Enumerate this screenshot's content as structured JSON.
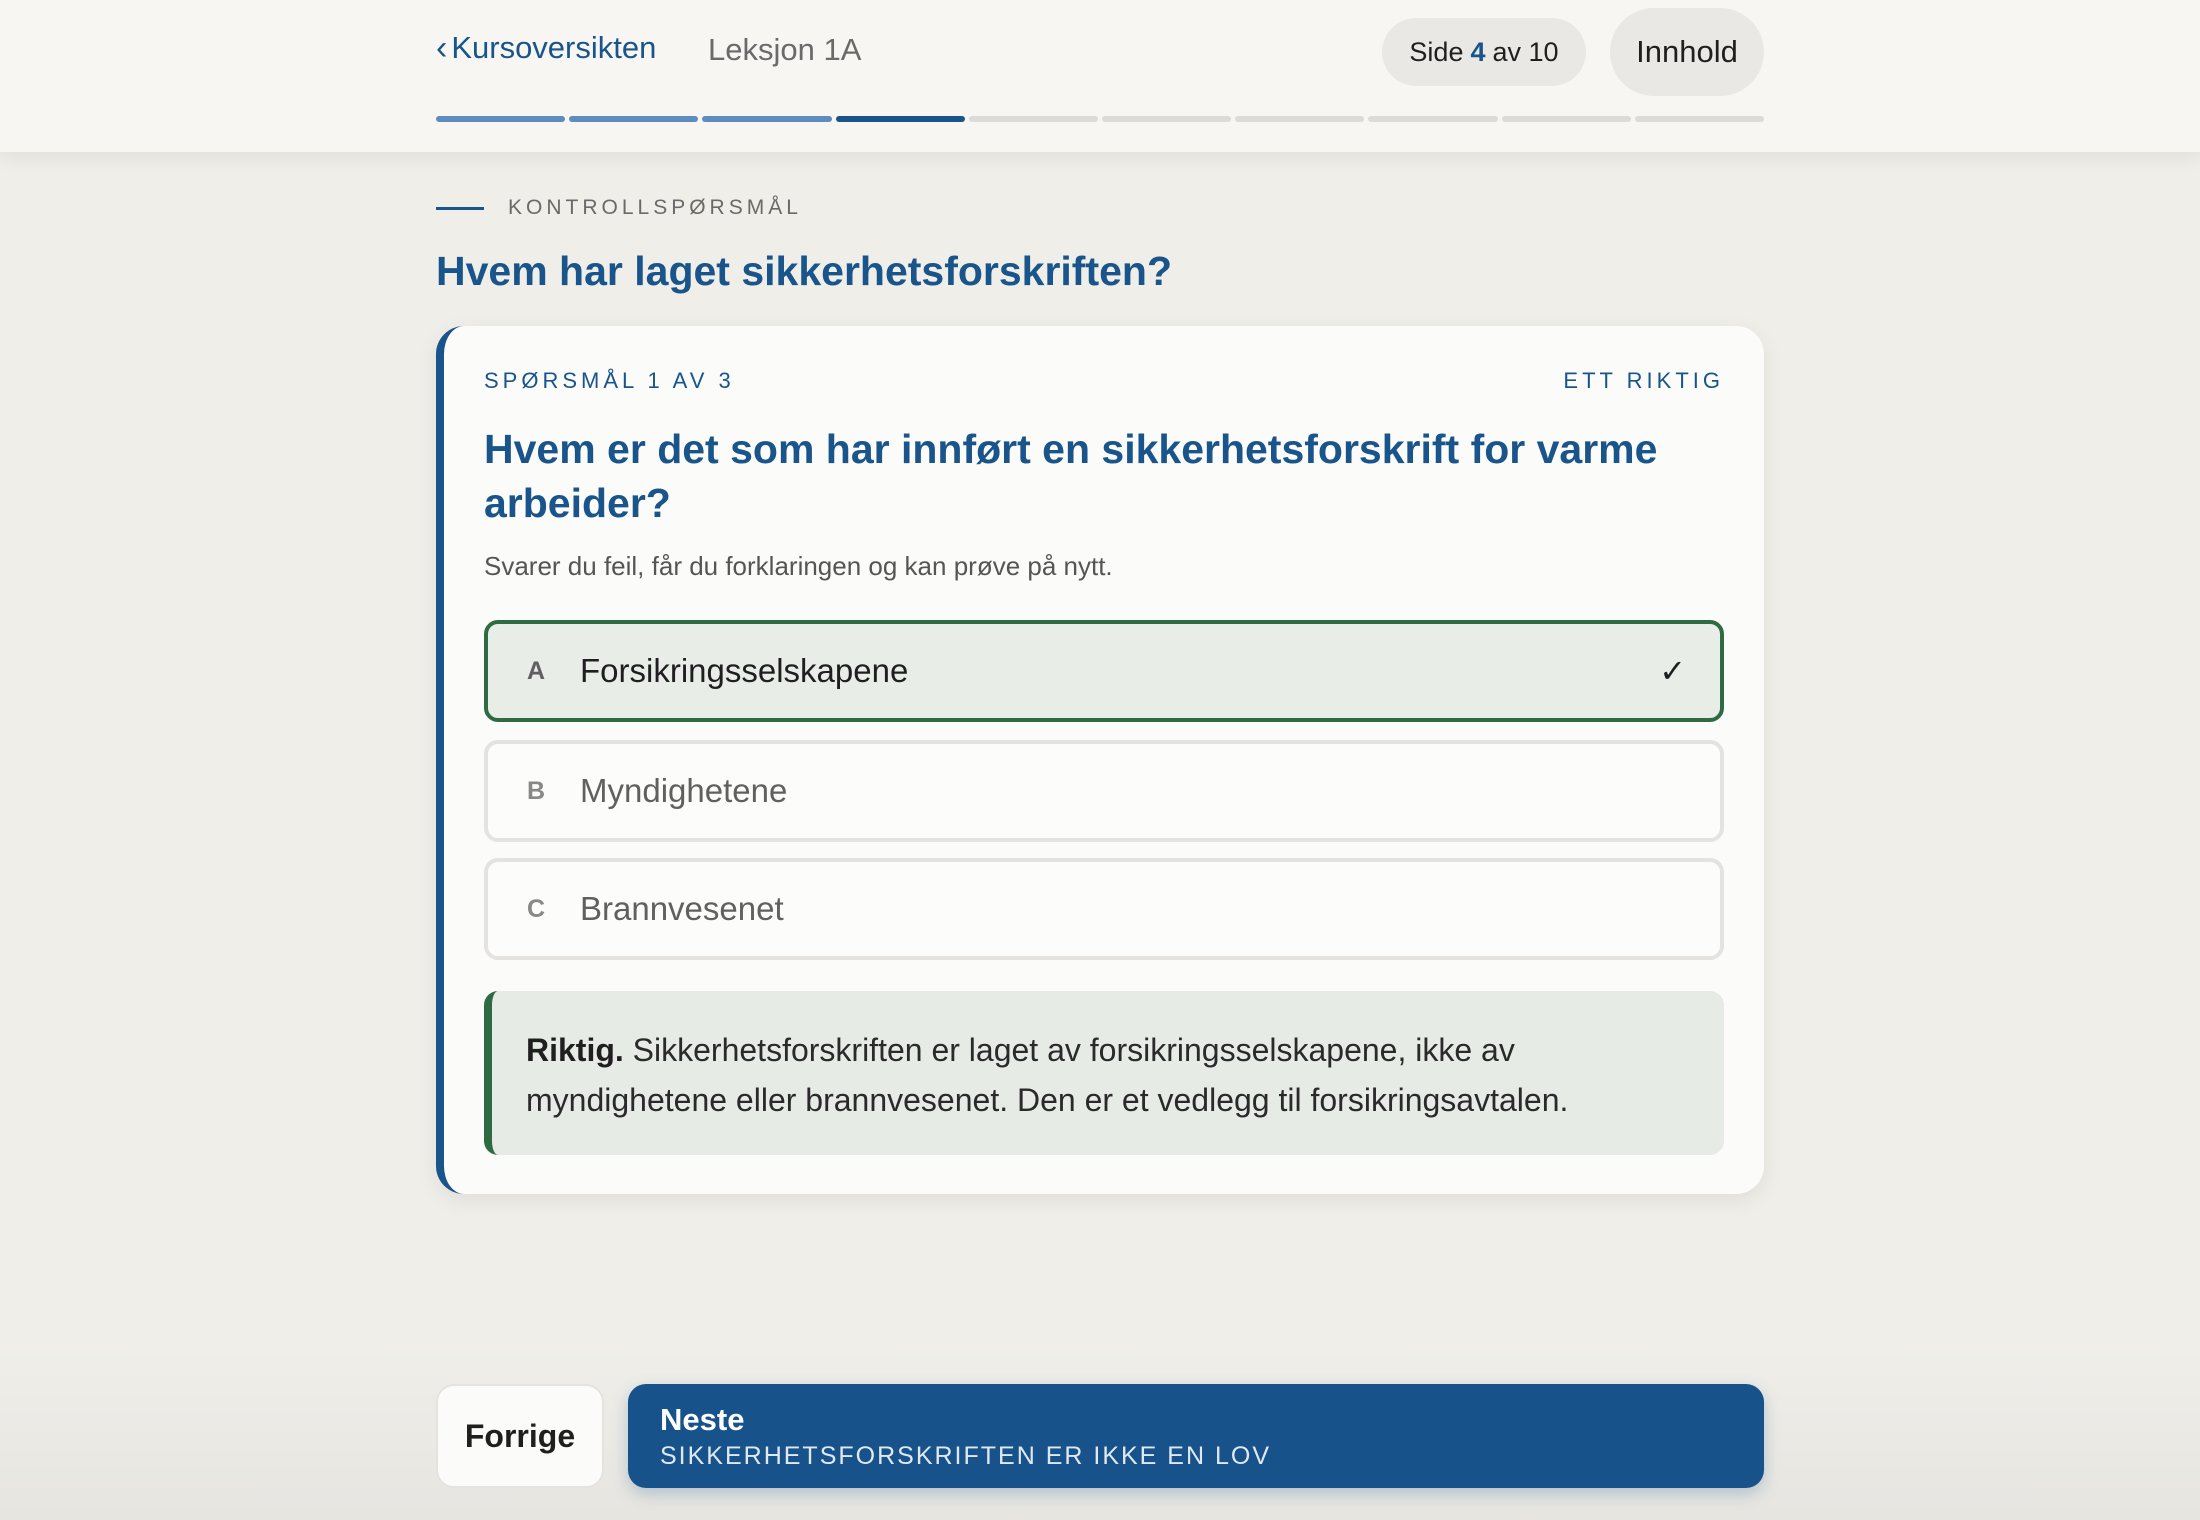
{
  "header": {
    "back_link": "Kursoversikten",
    "lesson": "Leksjon 1A",
    "page_prefix": "Side",
    "page_current": "4",
    "page_sep": "av 10",
    "toc_button": "Innhold",
    "progress": {
      "total_segments": 10,
      "completed": 3,
      "current_index": 4
    }
  },
  "section": {
    "eyebrow": "KONTROLLSPØRSMÅL",
    "title": "Hvem har laget sikkerhetsforskriften?"
  },
  "quiz": {
    "counter": "SPØRSMÅL 1 AV 3",
    "mode": "ETT RIKTIG",
    "question": "Hvem er det som har innført en sikkerhetsforskrift for varme arbeider?",
    "hint": "Svarer du feil, får du forklaringen og kan prøve på nytt.",
    "options": [
      {
        "letter": "A",
        "label": "Forsikringsselskapene",
        "selected": true
      },
      {
        "letter": "B",
        "label": "Myndighetene",
        "selected": false
      },
      {
        "letter": "C",
        "label": "Brannvesenet",
        "selected": false
      }
    ],
    "check_mark": "✓",
    "feedback": {
      "lead": "Riktig.",
      "text": "Sikkerhetsforskriften er laget av forsikringsselskapene, ikke av myndighetene eller brannvesenet. Den er et vedlegg til forsikringsavtalen."
    }
  },
  "nav": {
    "prev_label": "Forrige",
    "next_label": "Neste",
    "next_subtitle": "SIKKERHETSFORSKRIFTEN ER IKKE EN LOV"
  },
  "colors": {
    "brand": "#19548a",
    "correct": "#2e6b42",
    "background": "#efeee9"
  },
  "icons": {
    "back": "chevron-left-icon",
    "check": "checkmark-icon"
  }
}
